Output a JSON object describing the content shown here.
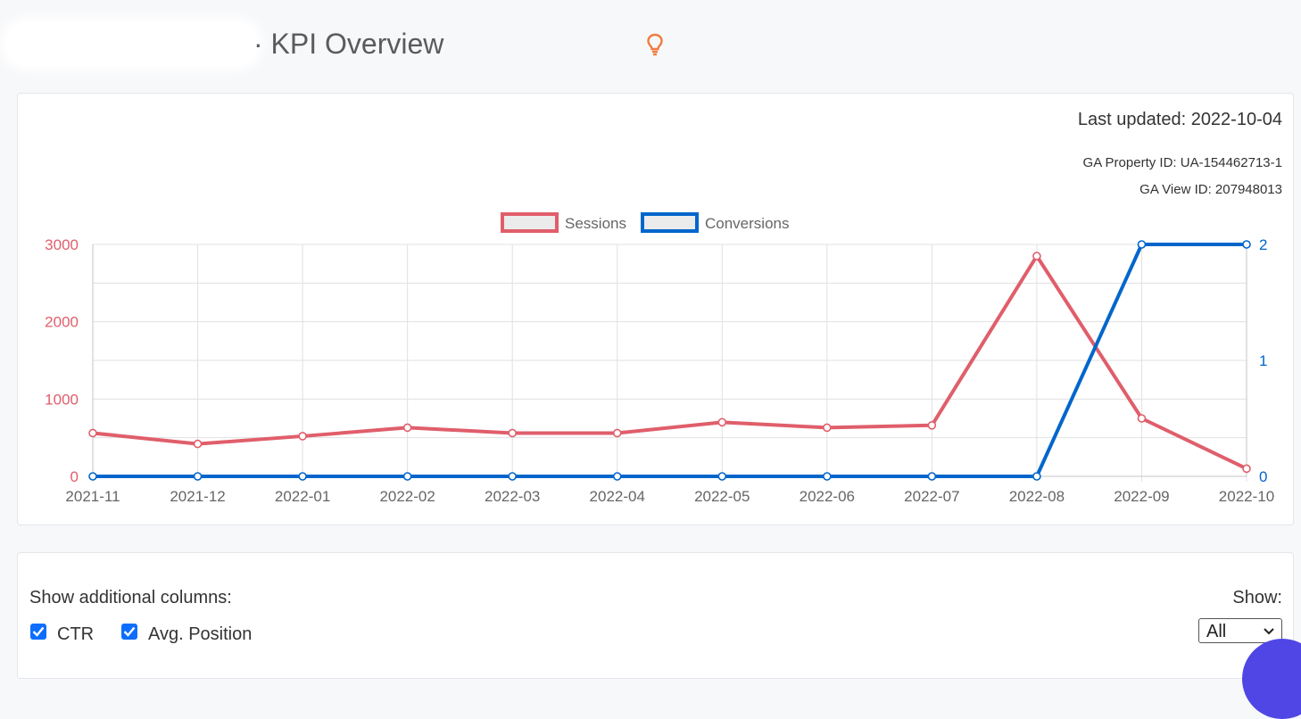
{
  "header": {
    "title": "· KPI Overview",
    "idea_icon": "lightbulb-icon",
    "idea_icon_color": "#f07b3f"
  },
  "chart_card": {
    "last_updated": "Last updated: 2022-10-04",
    "ga_property": "GA Property ID: UA-154462713-1",
    "ga_view": "GA View ID: 207948013"
  },
  "chart_data": {
    "type": "line",
    "title": "",
    "xlabel": "",
    "ylabel": "",
    "x": [
      "2021-11",
      "2021-12",
      "2022-01",
      "2022-02",
      "2022-03",
      "2022-04",
      "2022-05",
      "2022-06",
      "2022-07",
      "2022-08",
      "2022-09",
      "2022-10"
    ],
    "series": [
      {
        "name": "Sessions",
        "axis": "left",
        "color": "#e05e6b",
        "values": [
          560,
          420,
          520,
          630,
          560,
          560,
          700,
          630,
          660,
          2850,
          750,
          100
        ]
      },
      {
        "name": "Conversions",
        "axis": "right",
        "color": "#0066cc",
        "values": [
          0,
          0,
          0,
          0,
          0,
          0,
          0,
          0,
          0,
          0,
          2,
          2
        ]
      }
    ],
    "y_left": {
      "min": 0,
      "max": 3000,
      "ticks": [
        "0",
        "1000",
        "2000",
        "3000"
      ],
      "color": "#e05e6b"
    },
    "y_right": {
      "min": 0,
      "max": 2,
      "ticks": [
        "0",
        "1",
        "2"
      ],
      "color": "#0066cc"
    },
    "legend": "top-center",
    "grid": true
  },
  "filters": {
    "show_columns_label": "Show additional columns:",
    "checkboxes": [
      {
        "label": "CTR",
        "checked": true
      },
      {
        "label": "Avg. Position",
        "checked": true
      }
    ],
    "show_label": "Show:",
    "show_select_value": "All"
  }
}
